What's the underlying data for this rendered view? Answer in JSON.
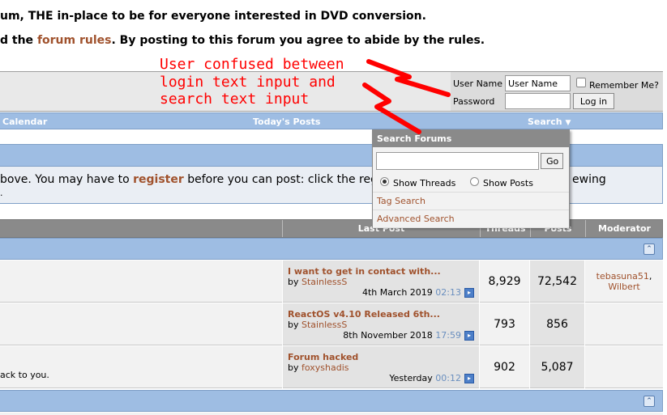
{
  "intro": {
    "line1": "um, THE in-place to be for everyone interested in DVD conversion.",
    "line2_pre": "d the ",
    "line2_link": "forum rules",
    "line2_post": ". By posting to this forum you agree to abide by the rules."
  },
  "login": {
    "username_label": "User Name",
    "username_value": "User Name",
    "remember_label": "Remember Me?",
    "password_label": "Password",
    "password_value": "",
    "login_button": "Log in"
  },
  "navbar": {
    "calendar": "Calendar",
    "todays_posts": "Today's Posts",
    "search": "Search"
  },
  "annotation": {
    "line1": "User confused between",
    "line2": "login text input and",
    "line3": "search text input",
    "color": "#ff0000"
  },
  "notice": {
    "pre": "bove. You may have to ",
    "link": "register",
    "post": " before you can post: click the regist",
    "tail": "ewing"
  },
  "table_header": {
    "last_post": "Last Post",
    "threads": "Threads",
    "posts": "Posts",
    "moderator": "Moderator"
  },
  "search_dropdown": {
    "title": "Search Forums",
    "input_value": "",
    "go_button": "Go",
    "show_threads": "Show Threads",
    "show_posts": "Show Posts",
    "tag_search": "Tag Search",
    "advanced_search": "Advanced Search"
  },
  "forums": [
    {
      "left_text": "",
      "last_title": "I want to get in contact with...",
      "by": "by",
      "author": "StainlessS",
      "date": "4th March 2019",
      "time": "02:13",
      "threads": "8,929",
      "posts": "72,542",
      "mod1": "tebasuna51",
      "mod2": "Wilbert"
    },
    {
      "left_text": "",
      "last_title": "ReactOS v4.10 Released 6th...",
      "by": "by",
      "author": "StainlessS",
      "date": "8th November 2018",
      "time": "17:59",
      "threads": "793",
      "posts": "856",
      "mod1": "",
      "mod2": ""
    },
    {
      "left_text": "ack to you.",
      "last_title": "Forum hacked",
      "by": "by",
      "author": "foxyshadis",
      "date": "Yesterday",
      "time": "00:12",
      "threads": "902",
      "posts": "5,087",
      "mod1": "",
      "mod2": ""
    }
  ],
  "colors": {
    "link": "#a0522d",
    "navbar": "#9ebde3",
    "header_gray": "#8a8a8a"
  }
}
